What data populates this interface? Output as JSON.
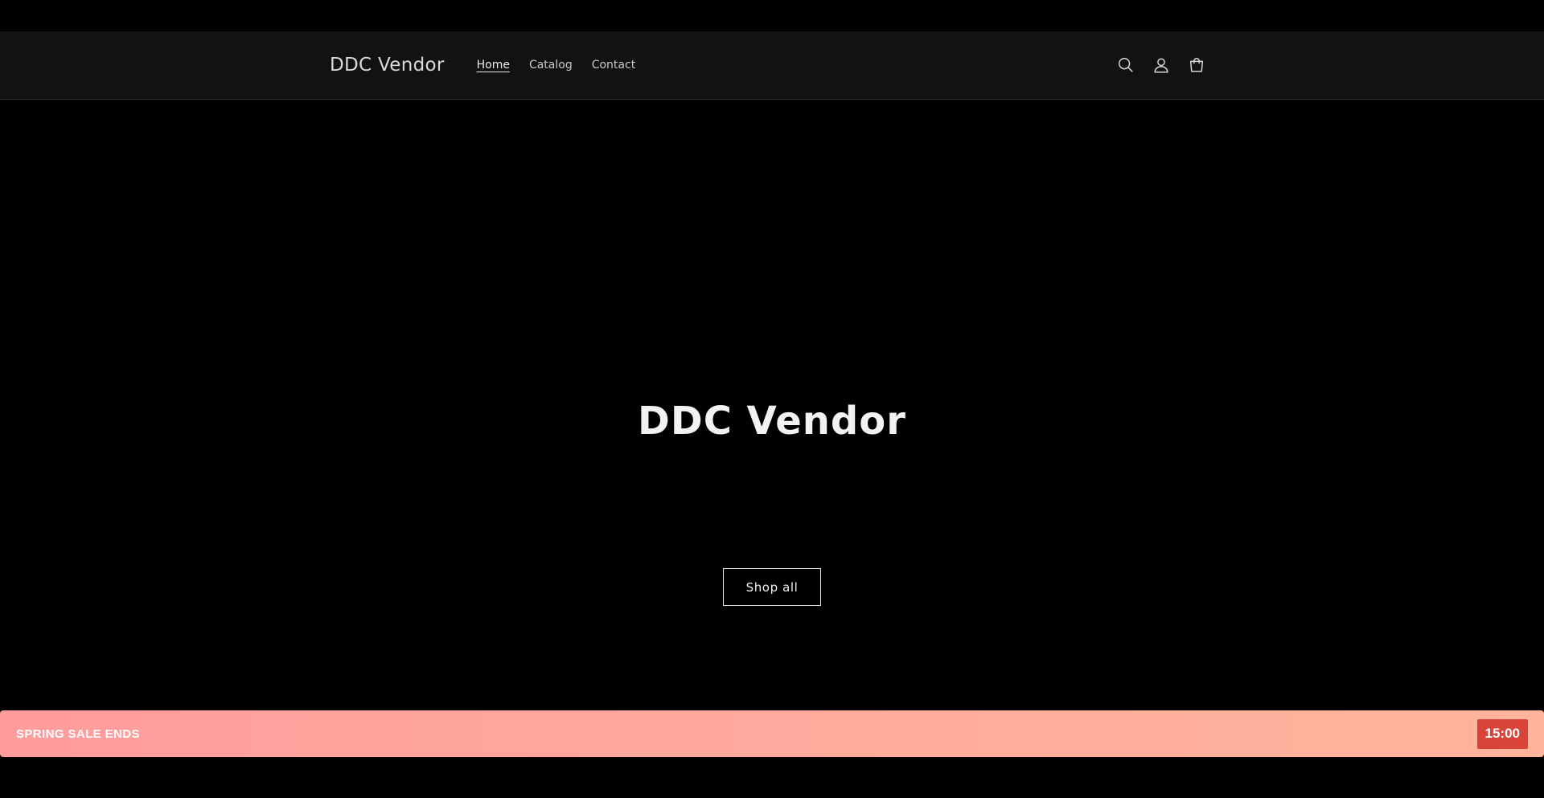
{
  "header": {
    "logo": "DDC Vendor",
    "nav": [
      {
        "label": "Home",
        "active": true
      },
      {
        "label": "Catalog",
        "active": false
      },
      {
        "label": "Contact",
        "active": false
      }
    ],
    "icons": [
      "search-icon",
      "account-icon",
      "cart-icon"
    ]
  },
  "hero": {
    "title": "DDC Vendor",
    "button_label": "Shop all"
  },
  "sale_bar": {
    "text": " SPRING SALE ENDS",
    "timer": "15:00",
    "colors": {
      "bar": "#ffa89c",
      "timer_bg": "#d9433a"
    }
  }
}
